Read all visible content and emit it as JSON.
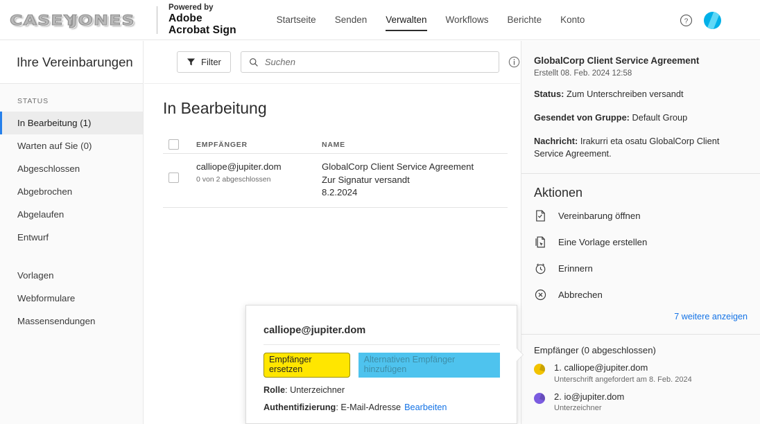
{
  "header": {
    "logo_left": "CASEY",
    "logo_right": "JONES",
    "powered_by": "Powered by",
    "brand_line1": "Adobe",
    "brand_line2": "Acrobat Sign",
    "nav": [
      {
        "label": "Startseite",
        "active": false
      },
      {
        "label": "Senden",
        "active": false
      },
      {
        "label": "Verwalten",
        "active": true
      },
      {
        "label": "Workflows",
        "active": false
      },
      {
        "label": "Berichte",
        "active": false
      },
      {
        "label": "Konto",
        "active": false
      }
    ],
    "help_icon": "question-circle-icon",
    "avatar_icon": "user-avatar"
  },
  "sidebar": {
    "title": "Ihre Vereinbarungen",
    "status_label": "STATUS",
    "items": [
      {
        "label": "In Bearbeitung (1)",
        "active": true
      },
      {
        "label": "Warten auf Sie (0)",
        "active": false
      },
      {
        "label": "Abgeschlossen",
        "active": false
      },
      {
        "label": "Abgebrochen",
        "active": false
      },
      {
        "label": "Abgelaufen",
        "active": false
      },
      {
        "label": "Entwurf",
        "active": false
      }
    ],
    "items2": [
      {
        "label": "Vorlagen"
      },
      {
        "label": "Webformulare"
      },
      {
        "label": "Massensendungen"
      }
    ]
  },
  "toolbar": {
    "filter_label": "Filter",
    "filter_icon": "funnel-icon",
    "search_placeholder": "Suchen",
    "search_value": "",
    "search_icon": "search-icon",
    "info_icon": "info-circle-icon"
  },
  "main": {
    "page_title": "In Bearbeitung",
    "columns": [
      "EMPFÄNGER",
      "NAME"
    ],
    "rows": [
      {
        "recipient": "calliope@jupiter.dom",
        "recipient_sub": "0 von 2 abgeschlossen",
        "name": "GlobalCorp Client Service Agreement",
        "name_sub1": "Zur Signatur versandt",
        "name_sub2": "8.2.2024"
      }
    ]
  },
  "right_panel": {
    "doc_title": "GlobalCorp Client Service Agreement",
    "created": "Erstellt 08. Feb. 2024 12:58",
    "status_key": "Status:",
    "status_value": "Zum Unterschreiben versandt",
    "group_key": "Gesendet von Gruppe:",
    "group_value": "Default Group",
    "message_key": "Nachricht:",
    "message_value": "Irakurri eta osatu GlobalCorp Client Service Agreement.",
    "actions_title": "Aktionen",
    "actions": [
      {
        "label": "Vereinbarung öffnen",
        "icon": "document-check-icon"
      },
      {
        "label": "Eine Vorlage erstellen",
        "icon": "document-template-icon"
      },
      {
        "label": "Erinnern",
        "icon": "alarm-clock-icon"
      },
      {
        "label": "Abbrechen",
        "icon": "cancel-circle-icon"
      }
    ],
    "more_link": "7 weitere anzeigen",
    "recipients_title": "Empfänger (0 abgeschlossen)",
    "recipients": [
      {
        "name": "1. calliope@jupiter.dom",
        "sub": "Unterschrift angefordert am 8. Feb. 2024",
        "color": "#f2c300"
      },
      {
        "name": "2. io@jupiter.dom",
        "sub": "Unterzeichner",
        "color": "#7b5ce0"
      }
    ]
  },
  "popover": {
    "title": "calliope@jupiter.dom",
    "replace_label": "Empfänger ersetzen",
    "alternate_label": "Alternativen Empfänger hinzufügen",
    "role_key": "Rolle",
    "role_value": "Unterzeichner",
    "auth_key": "Authentifizierung",
    "auth_value": "E-Mail-Adresse",
    "auth_link": "Bearbeiten"
  },
  "colors": {
    "accent_blue": "#2680eb",
    "link_blue": "#1473e6",
    "highlight_yellow": "#ffe600",
    "highlight_cyan": "#4ec3ee",
    "avatar_cyan": "#00b0e8"
  }
}
